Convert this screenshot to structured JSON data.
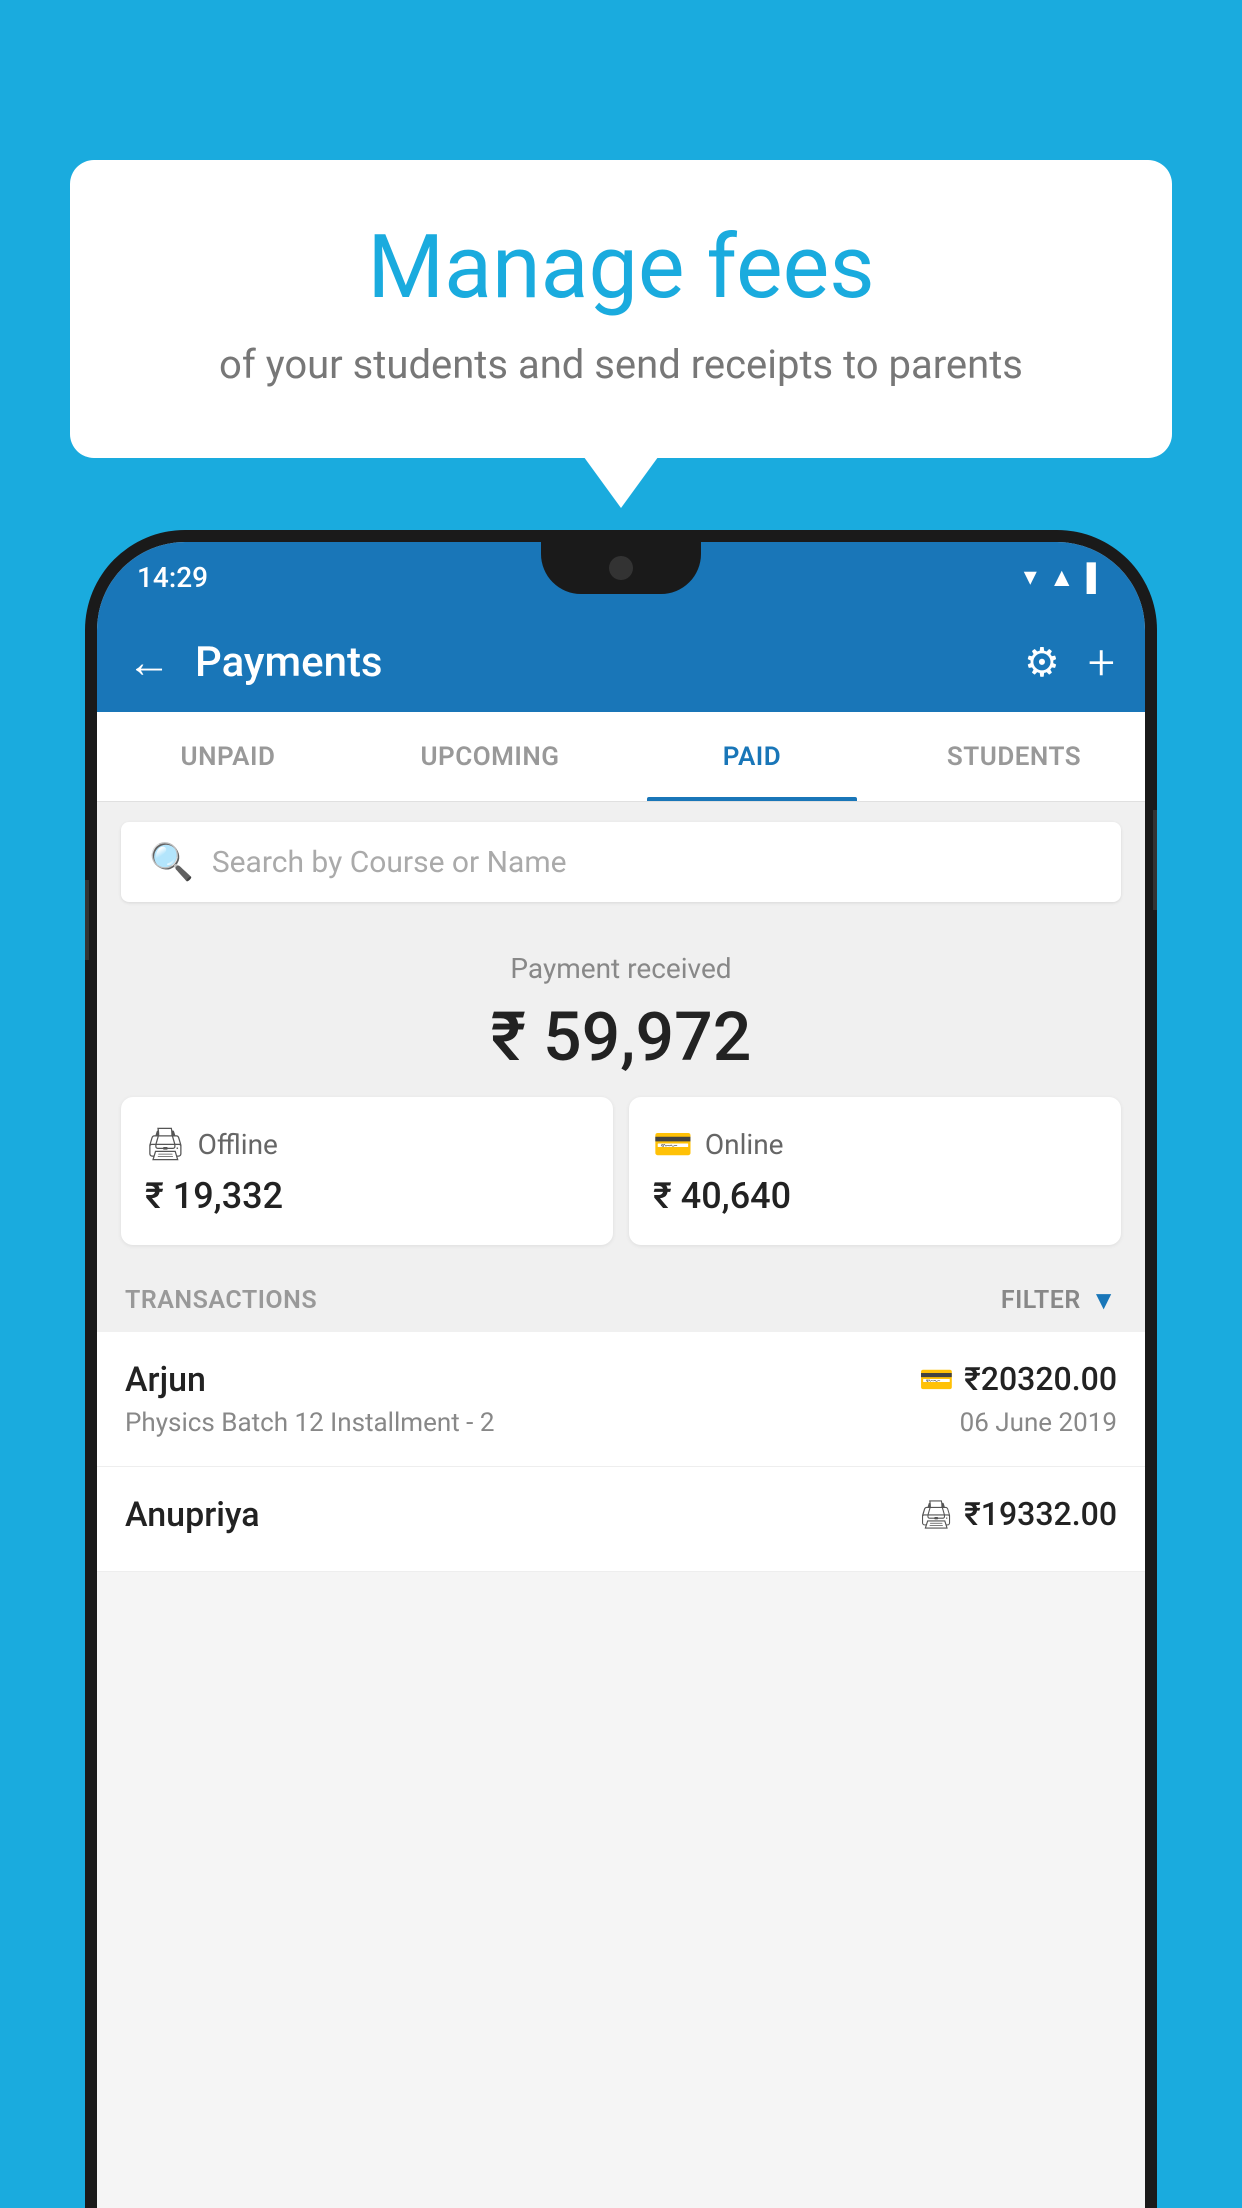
{
  "background_color": "#1AABDE",
  "speech_bubble": {
    "title": "Manage fees",
    "subtitle": "of your students and send receipts to parents"
  },
  "phone": {
    "status_bar": {
      "time": "14:29",
      "icons": [
        "wifi",
        "signal",
        "battery"
      ]
    },
    "app_bar": {
      "title": "Payments",
      "back_icon": "←",
      "gear_icon": "⚙",
      "plus_icon": "+"
    },
    "tabs": [
      {
        "label": "UNPAID",
        "active": false
      },
      {
        "label": "UPCOMING",
        "active": false
      },
      {
        "label": "PAID",
        "active": true
      },
      {
        "label": "STUDENTS",
        "active": false
      }
    ],
    "search": {
      "placeholder": "Search by Course or Name"
    },
    "payment_received": {
      "label": "Payment received",
      "amount": "₹ 59,972"
    },
    "payment_cards": [
      {
        "icon": "offline",
        "label": "Offline",
        "amount": "₹ 19,332"
      },
      {
        "icon": "online",
        "label": "Online",
        "amount": "₹ 40,640"
      }
    ],
    "transactions_header": {
      "label": "TRANSACTIONS",
      "filter_label": "FILTER"
    },
    "transactions": [
      {
        "name": "Arjun",
        "course": "Physics Batch 12 Installment - 2",
        "amount": "₹20320.00",
        "date": "06 June 2019",
        "payment_type": "online"
      },
      {
        "name": "Anupriya",
        "course": "",
        "amount": "₹19332.00",
        "date": "",
        "payment_type": "offline"
      }
    ]
  }
}
